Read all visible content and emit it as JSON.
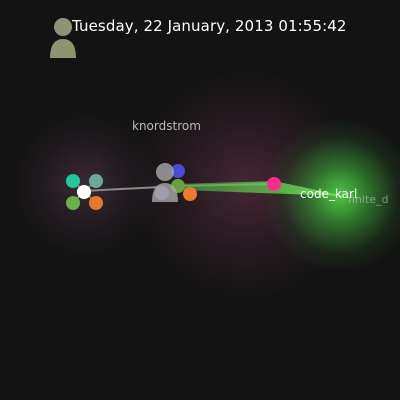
{
  "timestamp": "Tuesday, 22 January, 2013 01:55:42",
  "users": {
    "primary": "knordstrom",
    "secondary": "code_karl",
    "secondary_trailing": "finite_d"
  },
  "icons": {
    "top_avatar": "user-avatar-icon",
    "center_avatar": "user-avatar-icon",
    "right_avatar": "user-avatar-icon"
  },
  "colors": {
    "background": "#131313",
    "beam": "#5bd24a",
    "node_pink": "#ff2b8f",
    "node_orange": "#f08030",
    "node_teal": "#20d0a0",
    "node_green": "#6ab04a",
    "node_blue": "#5050e8"
  }
}
